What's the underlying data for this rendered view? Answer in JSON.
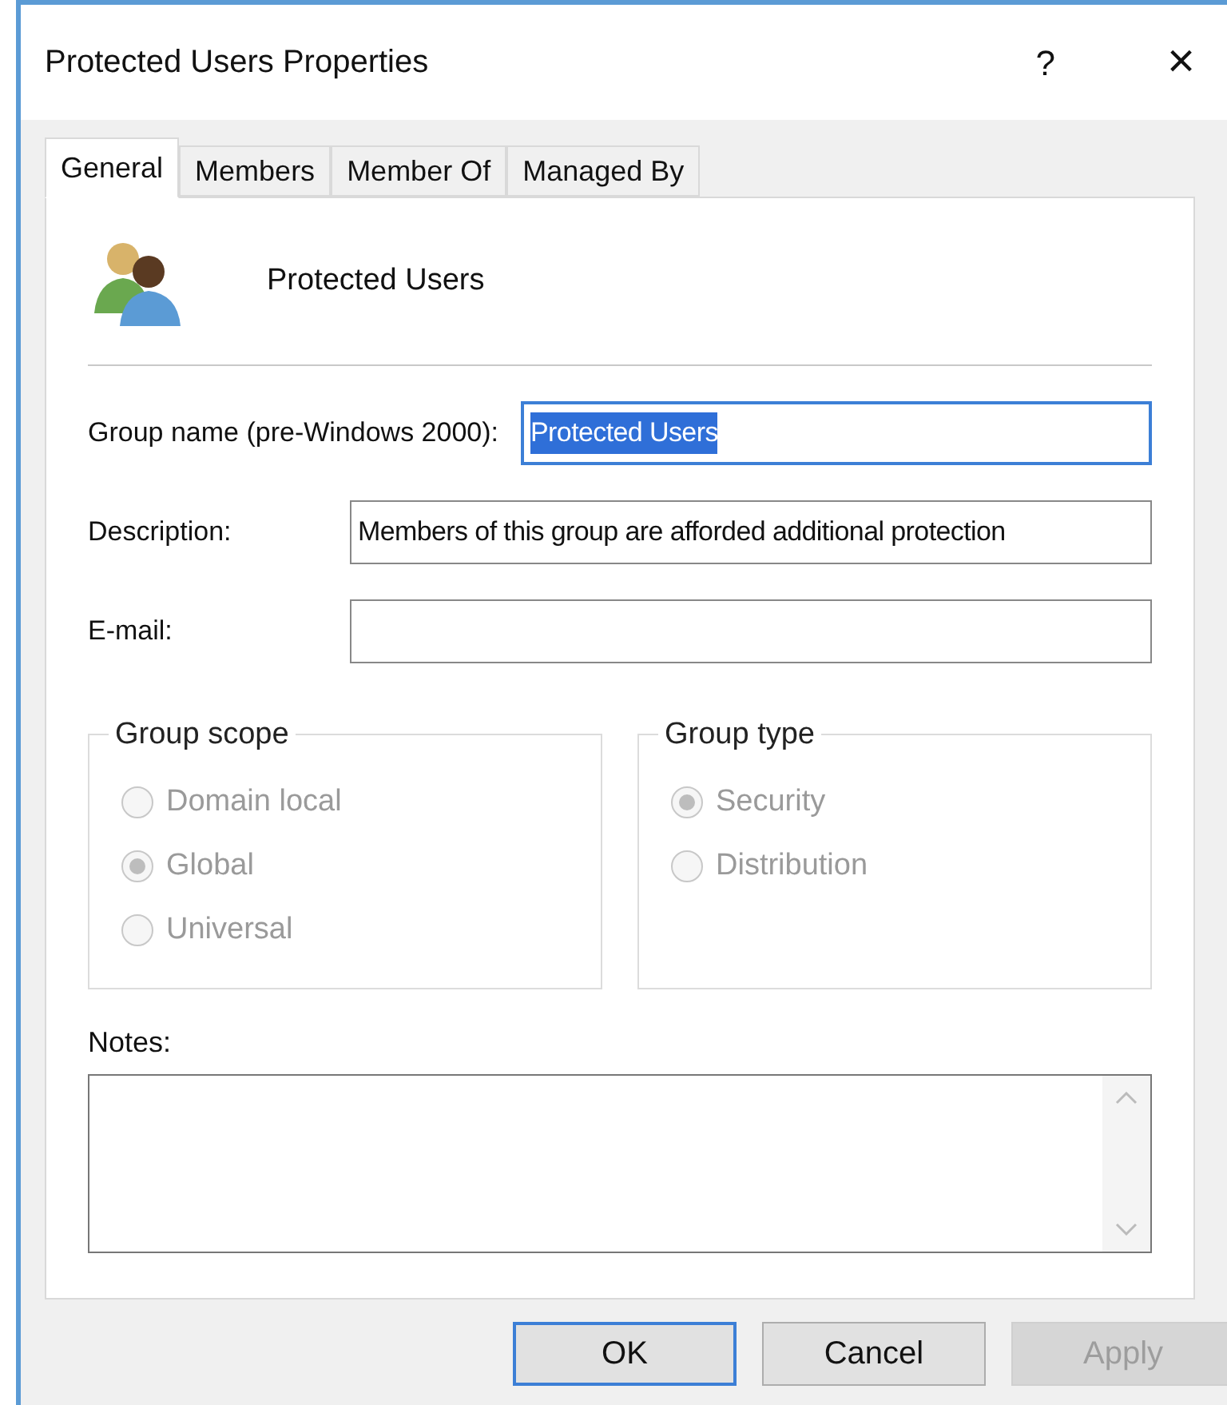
{
  "window": {
    "title": "Protected Users Properties",
    "help": "?",
    "close": "×"
  },
  "tabs": [
    {
      "label": "General",
      "selected": true
    },
    {
      "label": "Members",
      "selected": false
    },
    {
      "label": "Member Of",
      "selected": false
    },
    {
      "label": "Managed By",
      "selected": false
    }
  ],
  "group_header": {
    "name": "Protected Users"
  },
  "fields": [
    {
      "label": "Group name (pre-Windows 2000):",
      "value": "Protected Users",
      "focused": true,
      "text_selected": true
    },
    {
      "label": "Description:",
      "value": "Members of this group are afforded additional protection",
      "focused": false
    },
    {
      "label": "E-mail:",
      "focused": false
    }
  ],
  "group_scope": {
    "title": "Group scope",
    "options": [
      {
        "label": "Domain local",
        "selected": false,
        "disabled": true
      },
      {
        "label": "Global",
        "selected": true,
        "disabled": true
      },
      {
        "label": "Universal",
        "selected": false,
        "disabled": true
      }
    ]
  },
  "group_type": {
    "title": "Group type",
    "options": [
      {
        "label": "Security",
        "selected": true,
        "disabled": true
      },
      {
        "label": "Distribution",
        "selected": false,
        "disabled": true
      }
    ]
  },
  "notes": {
    "label": "Notes:"
  },
  "buttons": [
    {
      "label": "OK",
      "default": true,
      "disabled": false
    },
    {
      "label": "Cancel",
      "default": false,
      "disabled": false
    },
    {
      "label": "Apply",
      "default": false,
      "disabled": true
    }
  ]
}
